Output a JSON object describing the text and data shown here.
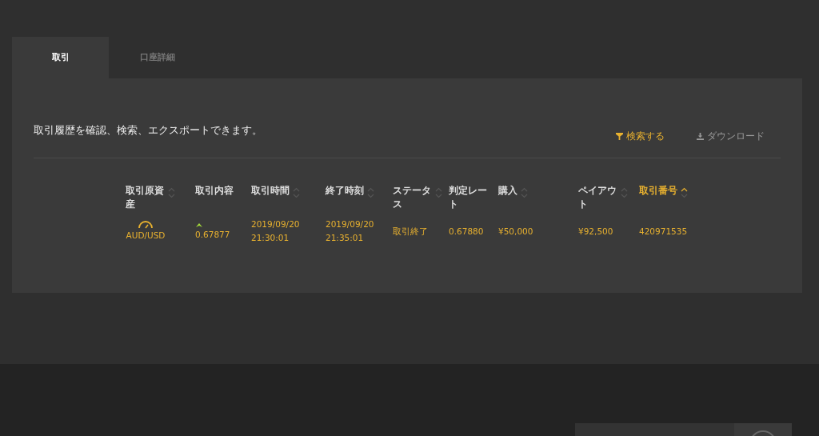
{
  "tabs": [
    {
      "label": "取引",
      "selected": true
    },
    {
      "label": "口座詳細",
      "selected": false
    }
  ],
  "description": "取引履歴を確認、検索、エクスポートできます。",
  "actions": [
    {
      "label": "検索する",
      "kind": "filter",
      "disabled": false
    },
    {
      "label": "ダウンロード",
      "kind": "download",
      "disabled": true
    }
  ],
  "table": {
    "columns": [
      {
        "label": "取引原資産",
        "sorted_ascending": false
      },
      {
        "label": "取引内容"
      },
      {
        "label": "取引時間",
        "sorted_ascending": false
      },
      {
        "label": "終了時刻",
        "sorted_ascending": false
      },
      {
        "label": "ステータス",
        "sorted_ascending": false
      },
      {
        "label": "判定レート"
      },
      {
        "label": "購入",
        "sorted_ascending": false
      },
      {
        "label": "ペイアウト",
        "sorted_ascending": false
      },
      {
        "label": "取引番号",
        "sorted_ascending": true
      }
    ],
    "rows": [
      {
        "asset": "AUD/USD",
        "rising": true,
        "entry_rate": "0.67877",
        "start_time": [
          "2019/09/20",
          "21:30:01"
        ],
        "end_time": [
          "2019/09/20",
          "21:35:01"
        ],
        "status": "取引終了",
        "closing_rate": "0.67880",
        "purchase": "¥50,000",
        "payout": "¥92,500",
        "trade_number": "420971535"
      }
    ]
  }
}
